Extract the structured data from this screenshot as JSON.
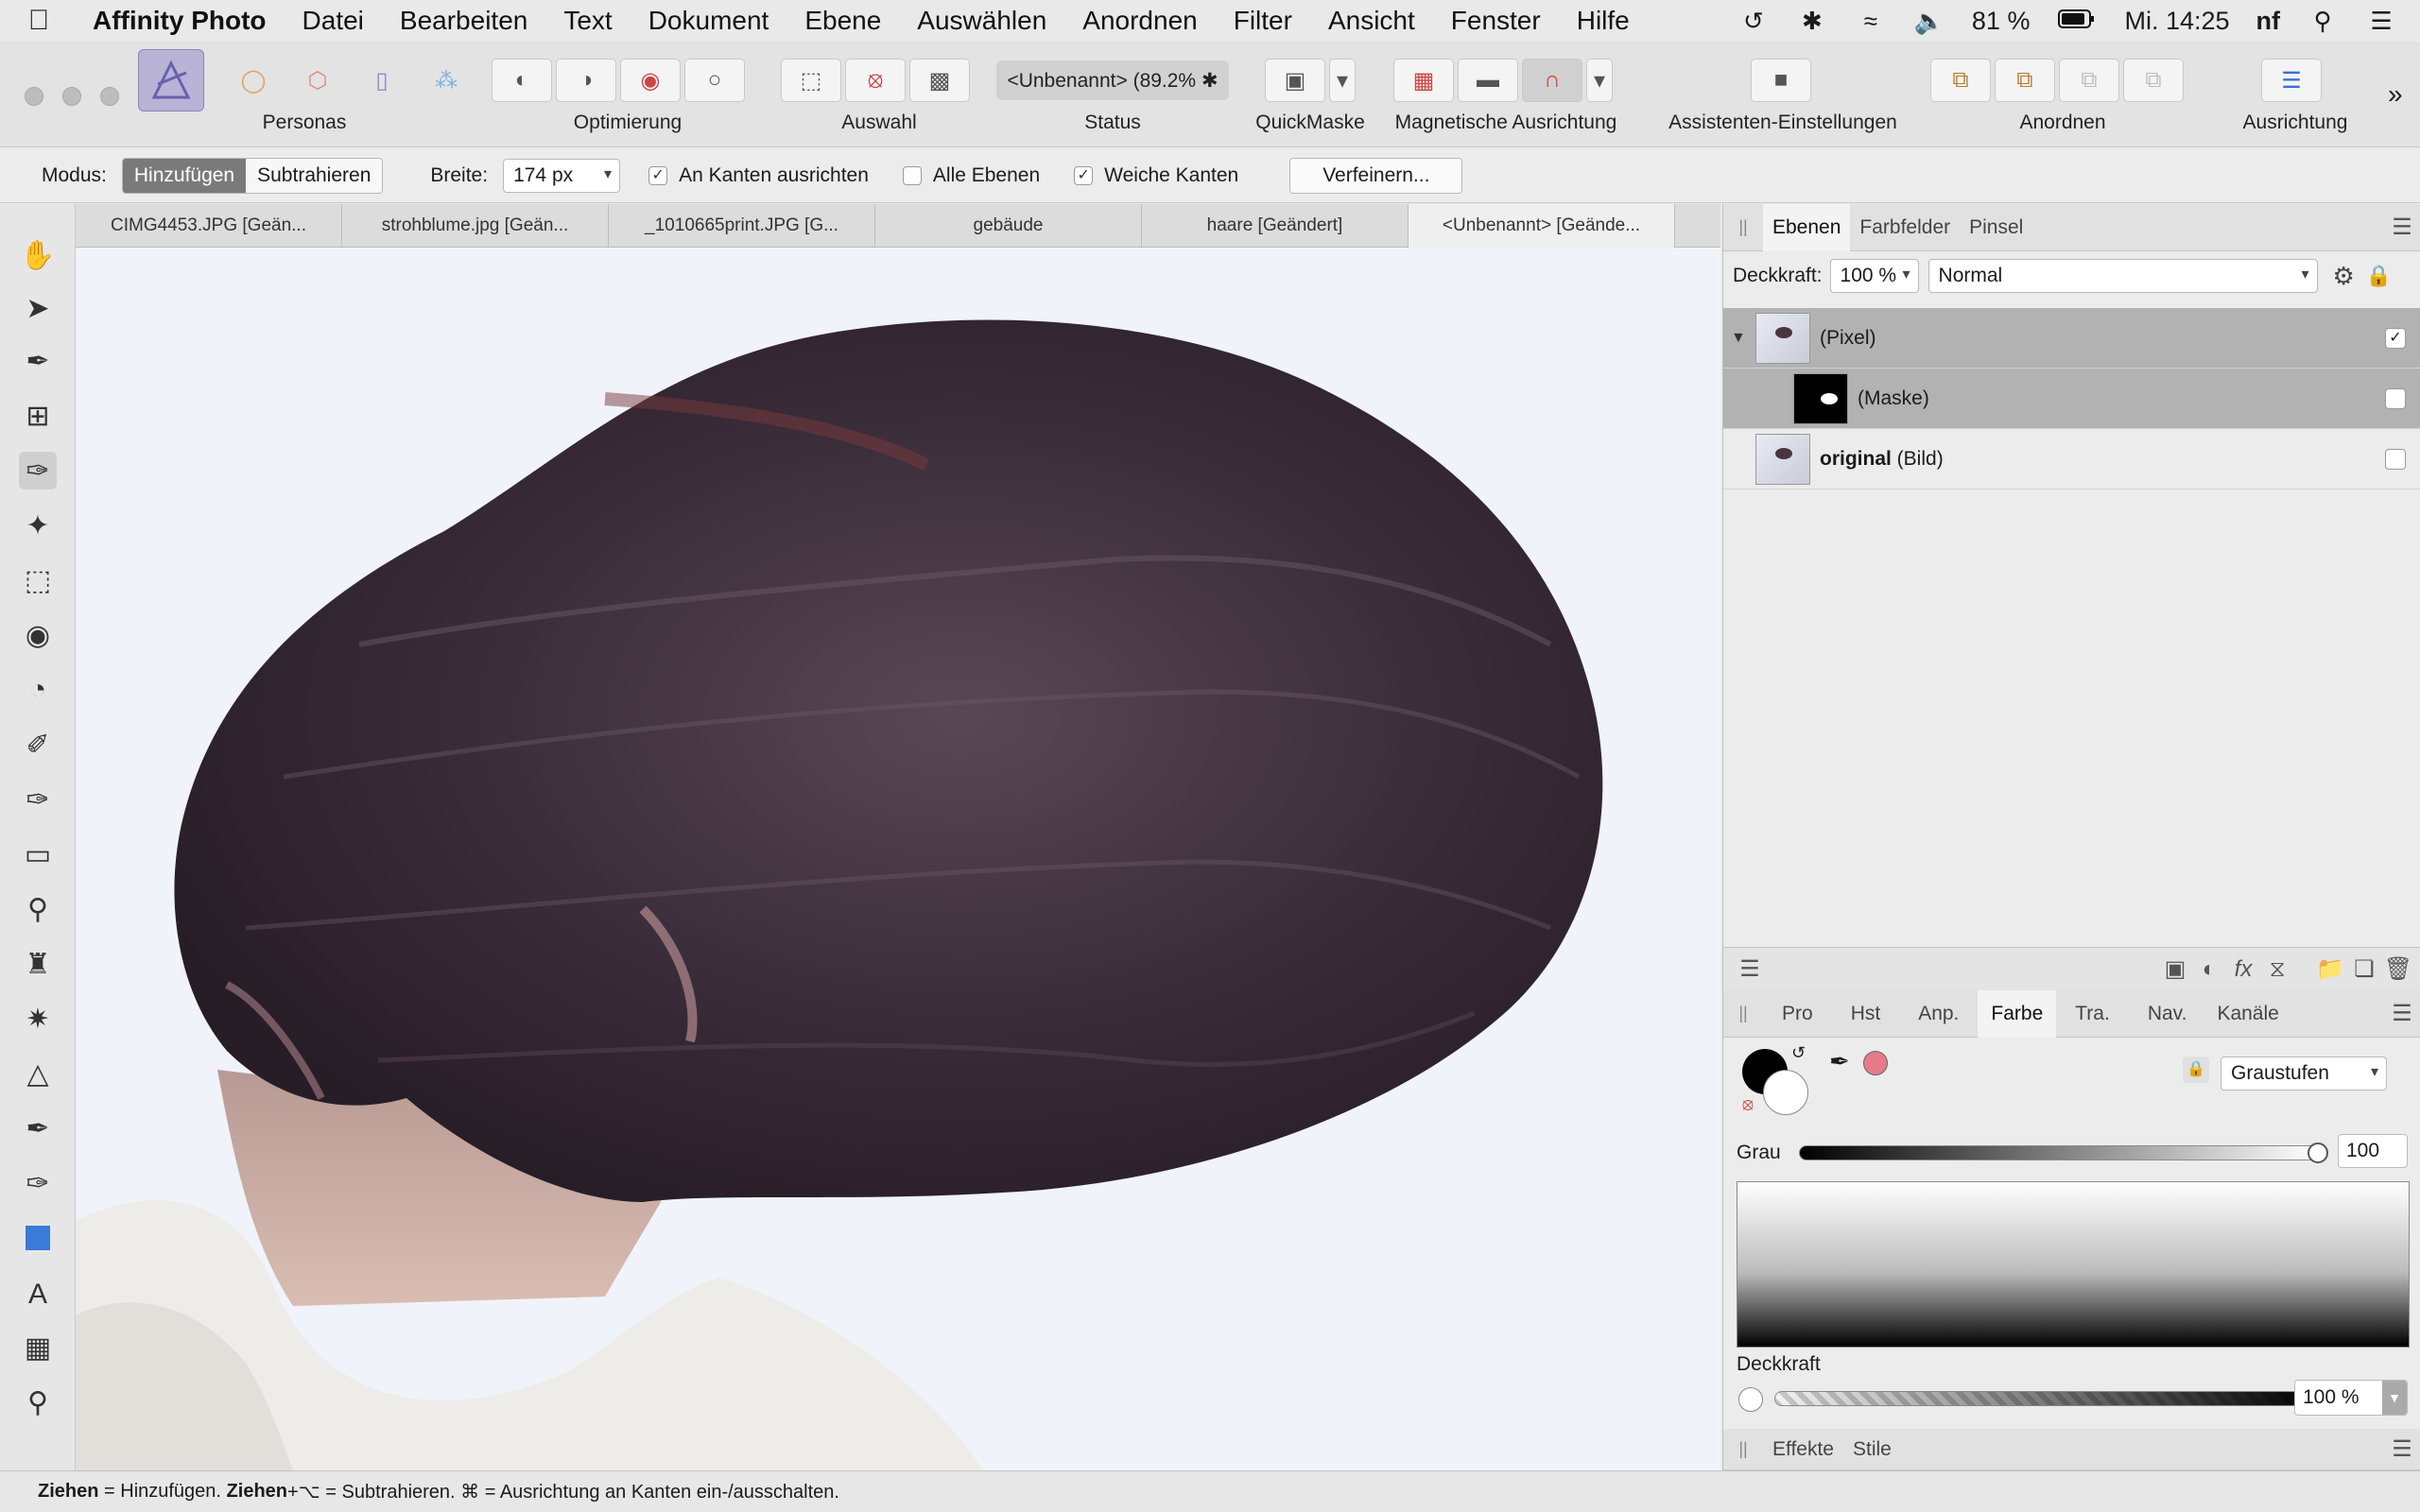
{
  "menubar": {
    "app_name": "Affinity Photo",
    "items": [
      "Datei",
      "Bearbeiten",
      "Text",
      "Dokument",
      "Ebene",
      "Auswählen",
      "Anordnen",
      "Filter",
      "Ansicht",
      "Fenster",
      "Hilfe"
    ],
    "battery": "81 %",
    "clock": "Mi. 14:25",
    "user": "nf"
  },
  "toolbar": {
    "personas_label": "Personas",
    "optimierung_label": "Optimierung",
    "auswahl_label": "Auswahl",
    "status_label": "Status",
    "status_value": "<Unbenannt> (89.2% ✱",
    "quickmask_label": "QuickMaske",
    "magnetic_label": "Magnetische Ausrichtung",
    "assistant_label": "Assistenten-Einstellungen",
    "arrange_label": "Anordnen",
    "align_label": "Ausrichtung"
  },
  "context": {
    "mode_label": "Modus:",
    "mode_add": "Hinzufügen",
    "mode_subtract": "Subtrahieren",
    "width_label": "Breite:",
    "width_value": "174 px",
    "snap_edges": "An Kanten ausrichten",
    "all_layers": "Alle Ebenen",
    "soft_edges": "Weiche Kanten",
    "refine": "Verfeinern..."
  },
  "doc_tabs": [
    "CIMG4453.JPG [Geän...",
    "strohblume.jpg [Geän...",
    "_1010665print.JPG [G...",
    "gebäude",
    "haare [Geändert]",
    "<Unbenannt> [Geände..."
  ],
  "layers_panel": {
    "tabs": [
      "Ebenen",
      "Farbfelder",
      "Pinsel"
    ],
    "opacity_label": "Deckkraft:",
    "opacity_value": "100 %",
    "blend_mode": "Normal",
    "layers": [
      {
        "name": "(Pixel)",
        "bold": "",
        "suffix": ""
      },
      {
        "name": "(Maske)",
        "bold": "",
        "suffix": ""
      },
      {
        "name": "",
        "bold": "original",
        "suffix": " (Bild)"
      }
    ]
  },
  "color_panel": {
    "tabs": [
      "Pro",
      "Hst",
      "Anp.",
      "Farbe",
      "Tra.",
      "Nav.",
      "Kanäle"
    ],
    "mode": "Graustufen",
    "grey_label": "Grau",
    "grey_value": "100",
    "opacity_label": "Deckkraft",
    "opacity_value": "100 %",
    "swatch_color": "#e77b8a"
  },
  "effects_panel": {
    "tabs": [
      "Effekte",
      "Stile"
    ]
  },
  "statusbar": {
    "drag": "Ziehen",
    "t1": " = Hinzufügen. ",
    "drag2": "Ziehen",
    "t2": "+⌥ = Subtrahieren. ⌘ = Ausrichtung an Kanten ein-/ausschalten."
  }
}
